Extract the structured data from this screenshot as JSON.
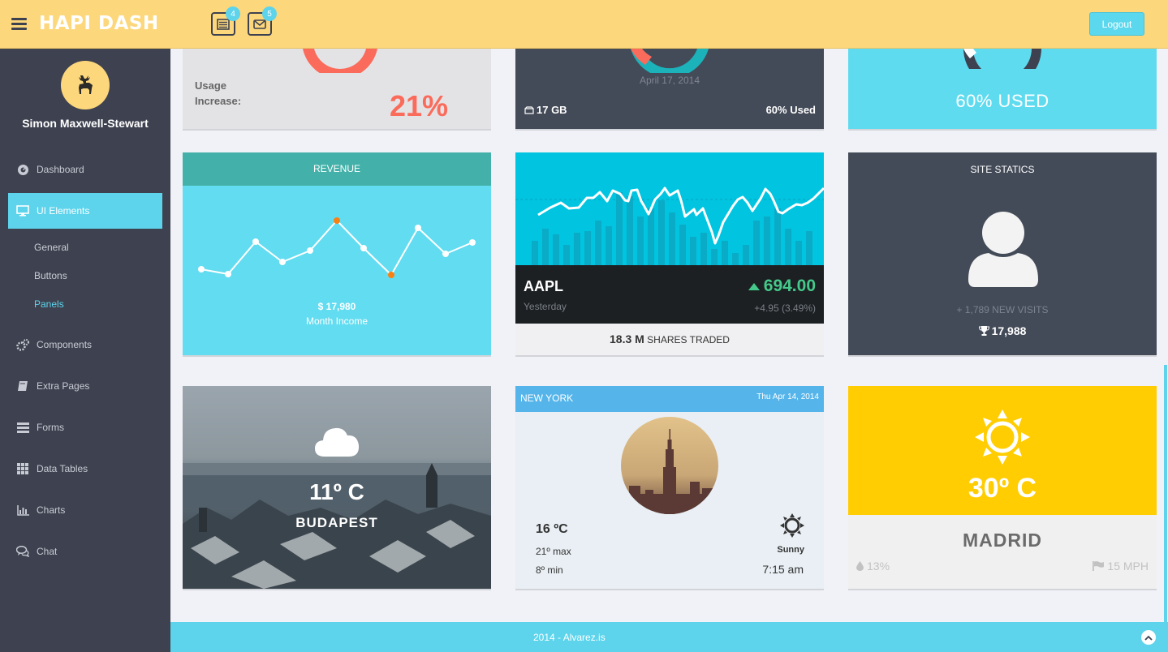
{
  "header": {
    "brand": "HAPI DASH",
    "tasks_badge": "4",
    "mail_badge": "5",
    "logout_label": "Logout"
  },
  "sidebar": {
    "user_name": "Simon Maxwell-Stewart",
    "items": [
      {
        "label": "Dashboard",
        "icon": "dashboard-icon"
      },
      {
        "label": "UI Elements",
        "icon": "desktop-icon"
      },
      {
        "label": "Components",
        "icon": "cogs-icon"
      },
      {
        "label": "Extra Pages",
        "icon": "book-icon"
      },
      {
        "label": "Forms",
        "icon": "tasks-icon"
      },
      {
        "label": "Data Tables",
        "icon": "th-icon"
      },
      {
        "label": "Charts",
        "icon": "bar-chart-icon"
      },
      {
        "label": "Chat",
        "icon": "comments-icon"
      }
    ],
    "sub_items": [
      "General",
      "Buttons",
      "Panels"
    ]
  },
  "top_row": {
    "usage_label": "Usage Increase:",
    "usage_value": "21%",
    "storage_date": "April 17, 2014",
    "storage_size": "17 GB",
    "storage_used": "60% Used",
    "disk_used": "60% USED"
  },
  "revenue": {
    "title": "REVENUE",
    "amount": "$ 17,980",
    "subtitle": "Month Income"
  },
  "stock": {
    "symbol": "AAPL",
    "period": "Yesterday",
    "price": "694.00",
    "change": "+4.95 (3.49%)",
    "volume": "18.3 M",
    "volume_label": "SHARES TRADED"
  },
  "site_stats": {
    "title": "SITE STATICS",
    "new_visits": "+ 1,789 NEW VISITS",
    "total": "17,988"
  },
  "budapest": {
    "temp": "11º C",
    "city": "BUDAPEST"
  },
  "newyork": {
    "city": "NEW YORK",
    "date": "Thu Apr 14, 2014",
    "temp": "16 ºC",
    "max": "21º max",
    "min": "8º min",
    "condition": "Sunny",
    "time": "7:15 am"
  },
  "madrid": {
    "temp": "30º C",
    "city": "MADRID",
    "humidity": "13%",
    "wind": "15 MPH"
  },
  "footer": {
    "text": "2014 - Alvarez.is"
  },
  "colors": {
    "accent": "#5dd4ec",
    "header": "#fdd77b",
    "sidebar": "#3e4250",
    "teal_header": "#43b1a9",
    "aapl_positive": "#45c98a",
    "madrid_yellow": "#ffcd02",
    "usage_red": "#fb6b5b"
  }
}
